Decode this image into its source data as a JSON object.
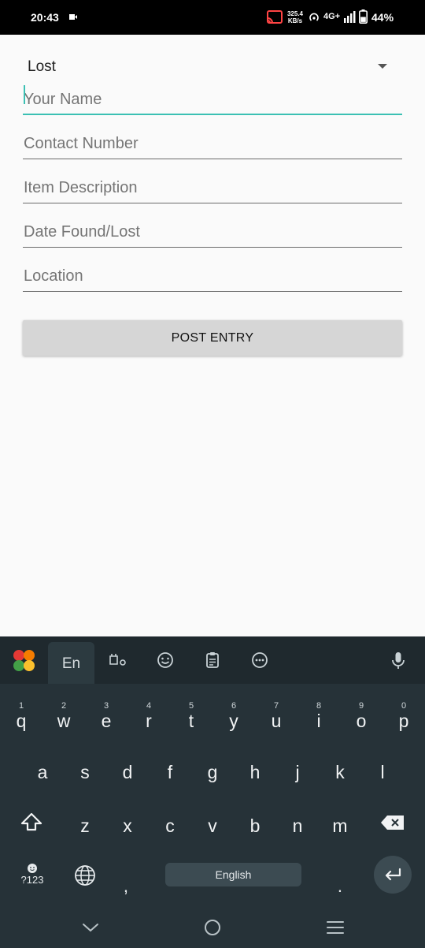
{
  "status_bar": {
    "time": "20:43",
    "speed_value": "325.4",
    "speed_unit": "KB/s",
    "network": "4G+",
    "battery": "44%"
  },
  "form": {
    "type_spinner": {
      "selected": "Lost"
    },
    "fields": {
      "name_placeholder": "Your Name",
      "contact_placeholder": "Contact Number",
      "description_placeholder": "Item Description",
      "date_placeholder": "Date Found/Lost",
      "location_placeholder": "Location"
    },
    "post_button": "POST ENTRY"
  },
  "keyboard": {
    "language_tab": "En",
    "row1": [
      {
        "hint": "1",
        "key": "q"
      },
      {
        "hint": "2",
        "key": "w"
      },
      {
        "hint": "3",
        "key": "e"
      },
      {
        "hint": "4",
        "key": "r"
      },
      {
        "hint": "5",
        "key": "t"
      },
      {
        "hint": "6",
        "key": "y"
      },
      {
        "hint": "7",
        "key": "u"
      },
      {
        "hint": "8",
        "key": "i"
      },
      {
        "hint": "9",
        "key": "o"
      },
      {
        "hint": "0",
        "key": "p"
      }
    ],
    "row2": [
      "a",
      "s",
      "d",
      "f",
      "g",
      "h",
      "j",
      "k",
      "l"
    ],
    "row3": [
      "z",
      "x",
      "c",
      "v",
      "b",
      "n",
      "m"
    ],
    "symbols_key": "?123",
    "comma_key": ",",
    "space_label": "English",
    "period_key": "."
  },
  "colors": {
    "accent": "#3bc0b3",
    "keyboard_bg": "#263238",
    "button_bg": "#d6d6d6"
  }
}
